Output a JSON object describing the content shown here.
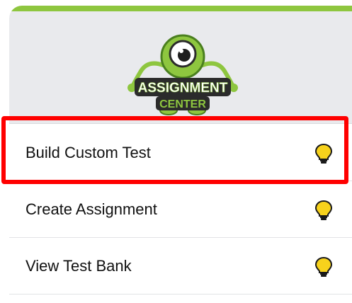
{
  "logo": {
    "line1": "ASSIGNMENT",
    "line2": "CENTER"
  },
  "menu": {
    "items": [
      {
        "label": "Build Custom Test",
        "icon": "lightbulb-icon"
      },
      {
        "label": "Create Assignment",
        "icon": "lightbulb-icon"
      },
      {
        "label": "View Test Bank",
        "icon": "lightbulb-icon"
      }
    ]
  },
  "colors": {
    "accent_green": "#8ec63f",
    "header_bg": "#e9eaed",
    "highlight": "#ff0000",
    "bulb": "#f7d21c"
  }
}
